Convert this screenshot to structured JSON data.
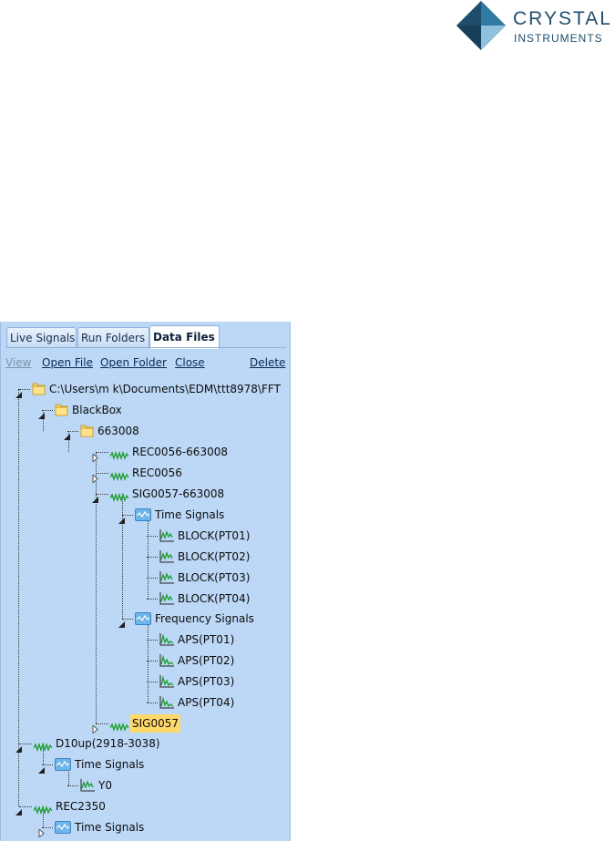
{
  "logo": {
    "line1": "CRYSTAL",
    "line2": "INSTRUMENTS"
  },
  "tabs": [
    {
      "label": "Live Signals",
      "active": false
    },
    {
      "label": "Run Folders",
      "active": false
    },
    {
      "label": "Data Files",
      "active": true
    }
  ],
  "toolbar": {
    "view": "View",
    "open_file": "Open File",
    "open_folder": "Open Folder",
    "close": "Close",
    "delete": "Delete"
  },
  "tree": [
    {
      "label": "C:\\Users\\m k\\Documents\\EDM\\ttt8978\\FFT",
      "icon": "folder-icon",
      "state": "expanded"
    },
    {
      "label": "BlackBox",
      "icon": "folder-icon",
      "state": "expanded"
    },
    {
      "label": "663008",
      "icon": "folder-icon",
      "state": "expanded"
    },
    {
      "label": "REC0056-663008",
      "icon": "signal-wave-icon",
      "state": "collapsed"
    },
    {
      "label": "REC0056",
      "icon": "signal-wave-icon",
      "state": "collapsed"
    },
    {
      "label": "SIG0057-663008",
      "icon": "signal-wave-icon",
      "state": "expanded"
    },
    {
      "label": "Time Signals",
      "icon": "signal-group-icon",
      "state": "expanded"
    },
    {
      "label": "BLOCK(PT01)",
      "icon": "chart-icon",
      "state": "leaf"
    },
    {
      "label": "BLOCK(PT02)",
      "icon": "chart-icon",
      "state": "leaf"
    },
    {
      "label": "BLOCK(PT03)",
      "icon": "chart-icon",
      "state": "leaf"
    },
    {
      "label": "BLOCK(PT04)",
      "icon": "chart-icon",
      "state": "leaf"
    },
    {
      "label": "Frequency Signals",
      "icon": "signal-group-icon",
      "state": "expanded"
    },
    {
      "label": "APS(PT01)",
      "icon": "spectrum-icon",
      "state": "leaf"
    },
    {
      "label": "APS(PT02)",
      "icon": "spectrum-icon",
      "state": "leaf"
    },
    {
      "label": "APS(PT03)",
      "icon": "spectrum-icon",
      "state": "leaf"
    },
    {
      "label": "APS(PT04)",
      "icon": "spectrum-icon",
      "state": "leaf"
    },
    {
      "label": "SIG0057",
      "icon": "signal-wave-icon",
      "state": "collapsed",
      "selected": true
    },
    {
      "label": "D10up(2918-3038)",
      "icon": "signal-wave-icon",
      "state": "expanded"
    },
    {
      "label": "Time Signals",
      "icon": "signal-group-icon",
      "state": "expanded"
    },
    {
      "label": "Y0",
      "icon": "chart-icon",
      "state": "leaf"
    },
    {
      "label": "REC2350",
      "icon": "signal-wave-icon",
      "state": "expanded"
    },
    {
      "label": "Time Signals",
      "icon": "signal-group-icon",
      "state": "collapsed"
    }
  ],
  "colors": {
    "panel_bg": "#bcd8f6",
    "selection": "#ffd86b",
    "signal_green": "#1a9c2a",
    "logo_blue": "#1f4e6b"
  }
}
